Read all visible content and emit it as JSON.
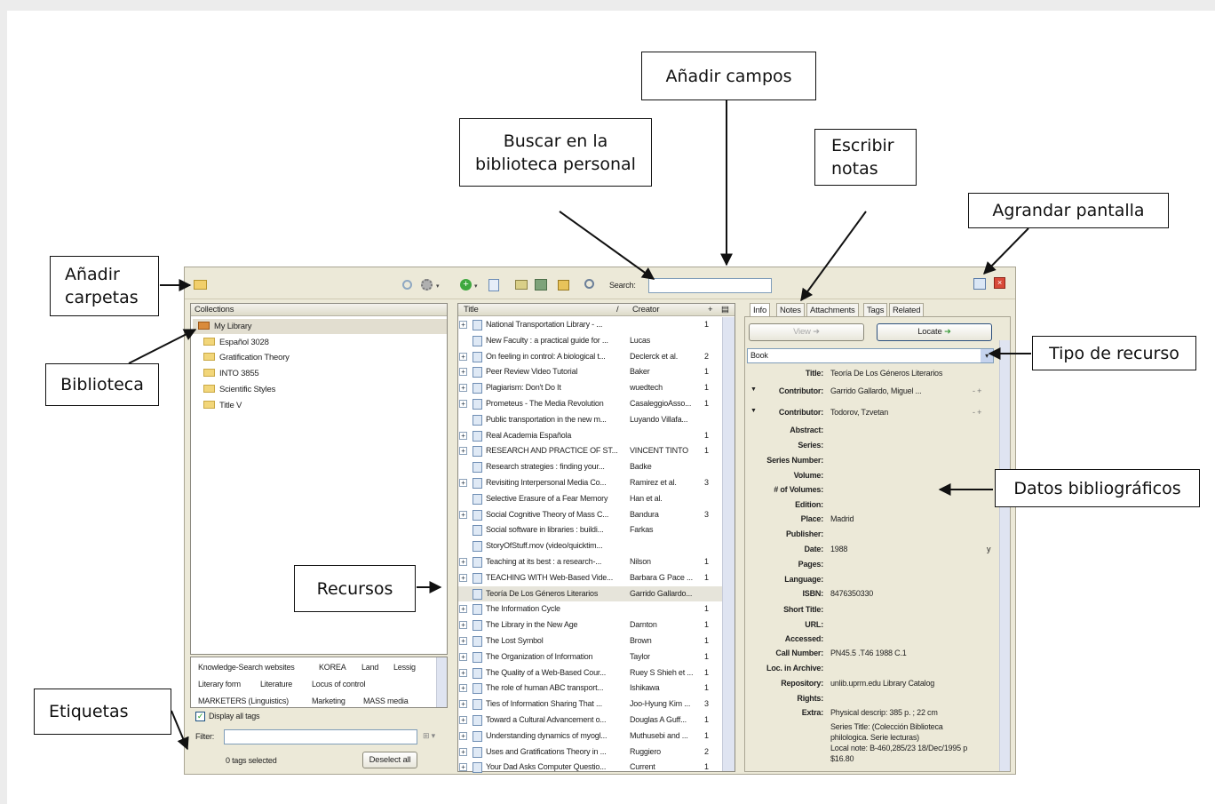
{
  "callouts": {
    "anadir_campos": "Añadir campos",
    "buscar": "Buscar en la biblioteca personal",
    "escribir_notas": "Escribir notas",
    "agrandar": "Agrandar pantalla",
    "anadir_carpetas": "Añadir carpetas",
    "biblioteca": "Biblioteca",
    "tipo_recurso": "Tipo de recurso",
    "datos": "Datos bibliográficos",
    "recursos": "Recursos",
    "etiquetas": "Etiquetas"
  },
  "toolbar": {
    "search_label": "Search:",
    "search_value": ""
  },
  "collections": {
    "header": "Collections",
    "items": [
      "My Library",
      "Español 3028",
      "Gratification Theory",
      "INTO 3855",
      "Scientific Styles",
      "Title V"
    ]
  },
  "tags": {
    "items": [
      "Knowledge-Search websites",
      "KOREA",
      "Land",
      "Lessig",
      "Literary form",
      "Literature",
      "Locus of control",
      "MARKETERS (Linguistics)",
      "Marketing",
      "MASS media"
    ],
    "display_all_label": "Display all tags",
    "filter_label": "Filter:",
    "filter_value": "",
    "selected_text": "0 tags selected",
    "deselect_label": "Deselect all"
  },
  "items_list": {
    "col_title": "Title",
    "col_creator": "Creator",
    "rows": [
      {
        "title": "National Transportation Library - ...",
        "creator": "",
        "notes": "1"
      },
      {
        "title": "New Faculty : a practical guide for ...",
        "creator": "Lucas",
        "notes": ""
      },
      {
        "title": "On feeling in control: A biological t...",
        "creator": "Declerck et al.",
        "notes": "2"
      },
      {
        "title": "Peer Review Video Tutorial",
        "creator": "Baker",
        "notes": "1"
      },
      {
        "title": "Plagiarism: Don't Do It",
        "creator": "wuedtech",
        "notes": "1"
      },
      {
        "title": "Prometeus - The Media Revolution",
        "creator": "CasaleggioAsso...",
        "notes": "1"
      },
      {
        "title": "Public transportation in the new m...",
        "creator": "Luyando Villafa...",
        "notes": ""
      },
      {
        "title": "Real Academia Española",
        "creator": "",
        "notes": "1"
      },
      {
        "title": "RESEARCH AND PRACTICE OF ST...",
        "creator": "VINCENT TINTO",
        "notes": "1"
      },
      {
        "title": "Research strategies : finding your...",
        "creator": "Badke",
        "notes": ""
      },
      {
        "title": "Revisiting Interpersonal Media Co...",
        "creator": "Ramirez et al.",
        "notes": "3"
      },
      {
        "title": "Selective Erasure of a Fear Memory",
        "creator": "Han et al.",
        "notes": ""
      },
      {
        "title": "Social Cognitive Theory of Mass C...",
        "creator": "Bandura",
        "notes": "3"
      },
      {
        "title": "Social software in libraries : buildi...",
        "creator": "Farkas",
        "notes": ""
      },
      {
        "title": "StoryOfStuff.mov (video/quicktim...",
        "creator": "",
        "notes": ""
      },
      {
        "title": "Teaching at its best : a research-...",
        "creator": "Nilson",
        "notes": "1"
      },
      {
        "title": "TEACHING WITH Web-Based Vide...",
        "creator": "Barbara G Pace ...",
        "notes": "1"
      },
      {
        "title": "Teoría De Los Géneros Literarios",
        "creator": "Garrido Gallardo...",
        "notes": ""
      },
      {
        "title": "The Information Cycle",
        "creator": "",
        "notes": "1"
      },
      {
        "title": "The Library in the New Age",
        "creator": "Darnton",
        "notes": "1"
      },
      {
        "title": "The Lost Symbol",
        "creator": "Brown",
        "notes": "1"
      },
      {
        "title": "The Organization of Information",
        "creator": "Taylor",
        "notes": "1"
      },
      {
        "title": "The Quality of a Web-Based Cour...",
        "creator": "Ruey S Shieh et ...",
        "notes": "1"
      },
      {
        "title": "The role of human ABC transport...",
        "creator": "Ishikawa",
        "notes": "1"
      },
      {
        "title": "Ties of Information Sharing That ...",
        "creator": "Joo-Hyung Kim ...",
        "notes": "3"
      },
      {
        "title": "Toward a Cultural Advancement o...",
        "creator": "Douglas A Guff...",
        "notes": "1"
      },
      {
        "title": "Understanding dynamics of myogl...",
        "creator": "Muthusebi and ...",
        "notes": "1"
      },
      {
        "title": "Uses and Gratifications Theory in ...",
        "creator": "Ruggiero",
        "notes": "2"
      },
      {
        "title": "Your Dad Asks Computer Questio...",
        "creator": "Current",
        "notes": "1"
      }
    ]
  },
  "item_pane": {
    "tabs": [
      "Info",
      "Notes",
      "Attachments",
      "Tags",
      "Related"
    ],
    "view_label": "View",
    "locate_label": "Locate",
    "item_type": "Book",
    "fields": [
      {
        "label": "Title:",
        "value": "Teoría De Los Géneros Literarios"
      },
      {
        "label": "Contributor:",
        "value": "Garrido Gallardo,   Miguel ..."
      },
      {
        "label": "Contributor:",
        "value": "Todorov,   Tzvetan"
      },
      {
        "label": "Abstract:",
        "value": ""
      },
      {
        "label": "Series:",
        "value": ""
      },
      {
        "label": "Series Number:",
        "value": ""
      },
      {
        "label": "Volume:",
        "value": ""
      },
      {
        "label": "# of Volumes:",
        "value": ""
      },
      {
        "label": "Edition:",
        "value": ""
      },
      {
        "label": "Place:",
        "value": "Madrid"
      },
      {
        "label": "Publisher:",
        "value": ""
      },
      {
        "label": "Date:",
        "value": "1988"
      },
      {
        "label": "Pages:",
        "value": ""
      },
      {
        "label": "Language:",
        "value": ""
      },
      {
        "label": "ISBN:",
        "value": "8476350330"
      },
      {
        "label": "Short Title:",
        "value": ""
      },
      {
        "label": "URL:",
        "value": ""
      },
      {
        "label": "Accessed:",
        "value": ""
      },
      {
        "label": "Call Number:",
        "value": "PN45.5 .T46 1988 C.1"
      },
      {
        "label": "Loc. in Archive:",
        "value": ""
      },
      {
        "label": "Repository:",
        "value": "unlib.uprm.edu Library Catalog"
      },
      {
        "label": "Rights:",
        "value": ""
      },
      {
        "label": "Extra:",
        "value": "Physical descrip: 385 p. ; 22 cm"
      }
    ],
    "extra_lines": [
      "Series Title: (Colección Biblioteca",
      "philologica. Serie lecturas)",
      "Local note: B-460,285/23 18/Dec/1995 p",
      "$16.80"
    ],
    "date_suffix": "y"
  }
}
